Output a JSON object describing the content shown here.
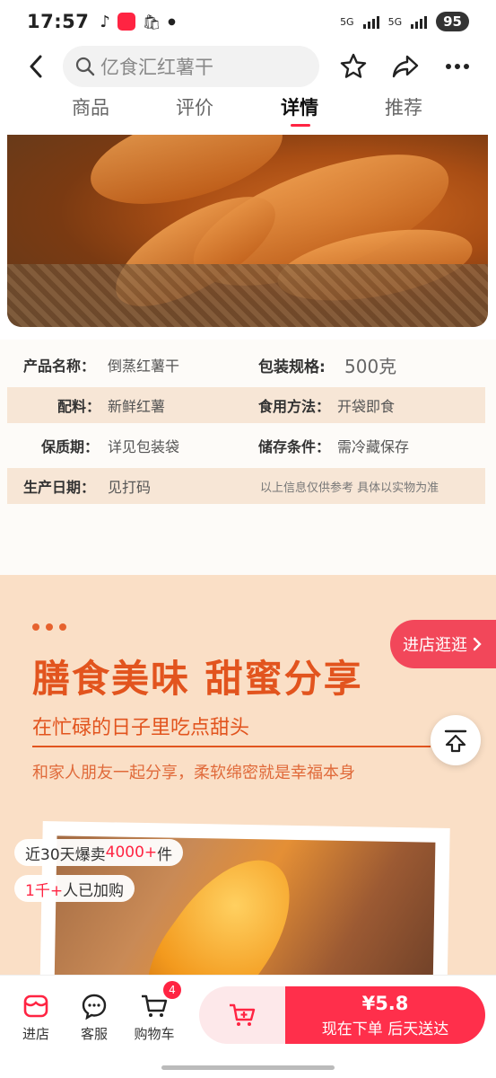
{
  "status_bar": {
    "time": "17:57",
    "app_badge": "小红书",
    "net1": "5G",
    "net2": "5G",
    "battery": "95"
  },
  "header": {
    "search_text": "亿食汇红薯干"
  },
  "tabs": [
    {
      "label": "商品"
    },
    {
      "label": "评价"
    },
    {
      "label": "详情"
    },
    {
      "label": "推荐"
    }
  ],
  "specs": {
    "row1": {
      "name_label": "产品名称：",
      "name_value": "倒蒸红薯干",
      "pack_label": "包装规格:",
      "pack_value": "500克"
    },
    "row2": {
      "ingredient_label": "配料：",
      "ingredient_value": "新鲜红薯",
      "usage_label": "食用方法：",
      "usage_value": "开袋即食"
    },
    "row3": {
      "shelf_label": "保质期：",
      "shelf_value": "详见包装袋",
      "storage_label": "储存条件：",
      "storage_value": "需冷藏保存"
    },
    "row4": {
      "date_label": "生产日期：",
      "date_value": "见打码",
      "note": "以上信息仅供参考 具体以实物为准"
    }
  },
  "promo": {
    "title": "膳食美味 甜蜜分享",
    "subtitle": "在忙碌的日子里吃点甜头",
    "description": "和家人朋友一起分享，柔软绵密就是幸福本身"
  },
  "sales": {
    "chip1_prefix": "近30天爆卖",
    "chip1_highlight": "4000+",
    "chip1_suffix": "件",
    "chip2_highlight": "1千+",
    "chip2_suffix": "人已加购"
  },
  "floating": {
    "visit_store": "进店逛逛"
  },
  "bottom": {
    "store": "进店",
    "service": "客服",
    "cart": "购物车",
    "cart_count": "4",
    "price": "¥5.8",
    "buy_label": "现在下单 后天送达"
  },
  "colors": {
    "accent": "#ff2442",
    "promo_text": "#e2541e",
    "promo_bg": "#fadfc6"
  }
}
